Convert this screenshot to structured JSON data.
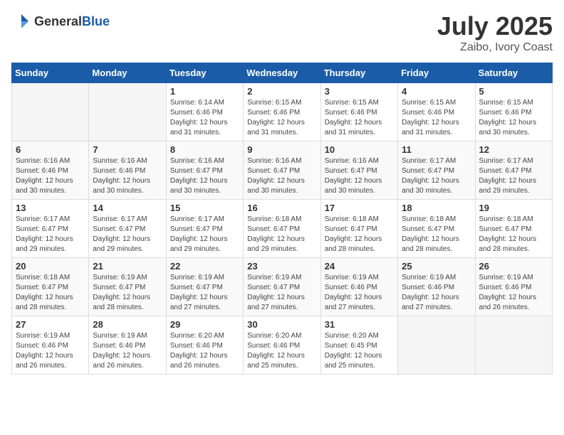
{
  "header": {
    "logo_general": "General",
    "logo_blue": "Blue",
    "month": "July 2025",
    "location": "Zaibo, Ivory Coast"
  },
  "weekdays": [
    "Sunday",
    "Monday",
    "Tuesday",
    "Wednesday",
    "Thursday",
    "Friday",
    "Saturday"
  ],
  "weeks": [
    [
      {
        "day": "",
        "sunrise": "",
        "sunset": "",
        "daylight": ""
      },
      {
        "day": "",
        "sunrise": "",
        "sunset": "",
        "daylight": ""
      },
      {
        "day": "1",
        "sunrise": "Sunrise: 6:14 AM",
        "sunset": "Sunset: 6:46 PM",
        "daylight": "Daylight: 12 hours and 31 minutes."
      },
      {
        "day": "2",
        "sunrise": "Sunrise: 6:15 AM",
        "sunset": "Sunset: 6:46 PM",
        "daylight": "Daylight: 12 hours and 31 minutes."
      },
      {
        "day": "3",
        "sunrise": "Sunrise: 6:15 AM",
        "sunset": "Sunset: 6:46 PM",
        "daylight": "Daylight: 12 hours and 31 minutes."
      },
      {
        "day": "4",
        "sunrise": "Sunrise: 6:15 AM",
        "sunset": "Sunset: 6:46 PM",
        "daylight": "Daylight: 12 hours and 31 minutes."
      },
      {
        "day": "5",
        "sunrise": "Sunrise: 6:15 AM",
        "sunset": "Sunset: 6:46 PM",
        "daylight": "Daylight: 12 hours and 30 minutes."
      }
    ],
    [
      {
        "day": "6",
        "sunrise": "Sunrise: 6:16 AM",
        "sunset": "Sunset: 6:46 PM",
        "daylight": "Daylight: 12 hours and 30 minutes."
      },
      {
        "day": "7",
        "sunrise": "Sunrise: 6:16 AM",
        "sunset": "Sunset: 6:46 PM",
        "daylight": "Daylight: 12 hours and 30 minutes."
      },
      {
        "day": "8",
        "sunrise": "Sunrise: 6:16 AM",
        "sunset": "Sunset: 6:47 PM",
        "daylight": "Daylight: 12 hours and 30 minutes."
      },
      {
        "day": "9",
        "sunrise": "Sunrise: 6:16 AM",
        "sunset": "Sunset: 6:47 PM",
        "daylight": "Daylight: 12 hours and 30 minutes."
      },
      {
        "day": "10",
        "sunrise": "Sunrise: 6:16 AM",
        "sunset": "Sunset: 6:47 PM",
        "daylight": "Daylight: 12 hours and 30 minutes."
      },
      {
        "day": "11",
        "sunrise": "Sunrise: 6:17 AM",
        "sunset": "Sunset: 6:47 PM",
        "daylight": "Daylight: 12 hours and 30 minutes."
      },
      {
        "day": "12",
        "sunrise": "Sunrise: 6:17 AM",
        "sunset": "Sunset: 6:47 PM",
        "daylight": "Daylight: 12 hours and 29 minutes."
      }
    ],
    [
      {
        "day": "13",
        "sunrise": "Sunrise: 6:17 AM",
        "sunset": "Sunset: 6:47 PM",
        "daylight": "Daylight: 12 hours and 29 minutes."
      },
      {
        "day": "14",
        "sunrise": "Sunrise: 6:17 AM",
        "sunset": "Sunset: 6:47 PM",
        "daylight": "Daylight: 12 hours and 29 minutes."
      },
      {
        "day": "15",
        "sunrise": "Sunrise: 6:17 AM",
        "sunset": "Sunset: 6:47 PM",
        "daylight": "Daylight: 12 hours and 29 minutes."
      },
      {
        "day": "16",
        "sunrise": "Sunrise: 6:18 AM",
        "sunset": "Sunset: 6:47 PM",
        "daylight": "Daylight: 12 hours and 29 minutes."
      },
      {
        "day": "17",
        "sunrise": "Sunrise: 6:18 AM",
        "sunset": "Sunset: 6:47 PM",
        "daylight": "Daylight: 12 hours and 28 minutes."
      },
      {
        "day": "18",
        "sunrise": "Sunrise: 6:18 AM",
        "sunset": "Sunset: 6:47 PM",
        "daylight": "Daylight: 12 hours and 28 minutes."
      },
      {
        "day": "19",
        "sunrise": "Sunrise: 6:18 AM",
        "sunset": "Sunset: 6:47 PM",
        "daylight": "Daylight: 12 hours and 28 minutes."
      }
    ],
    [
      {
        "day": "20",
        "sunrise": "Sunrise: 6:18 AM",
        "sunset": "Sunset: 6:47 PM",
        "daylight": "Daylight: 12 hours and 28 minutes."
      },
      {
        "day": "21",
        "sunrise": "Sunrise: 6:19 AM",
        "sunset": "Sunset: 6:47 PM",
        "daylight": "Daylight: 12 hours and 28 minutes."
      },
      {
        "day": "22",
        "sunrise": "Sunrise: 6:19 AM",
        "sunset": "Sunset: 6:47 PM",
        "daylight": "Daylight: 12 hours and 27 minutes."
      },
      {
        "day": "23",
        "sunrise": "Sunrise: 6:19 AM",
        "sunset": "Sunset: 6:47 PM",
        "daylight": "Daylight: 12 hours and 27 minutes."
      },
      {
        "day": "24",
        "sunrise": "Sunrise: 6:19 AM",
        "sunset": "Sunset: 6:46 PM",
        "daylight": "Daylight: 12 hours and 27 minutes."
      },
      {
        "day": "25",
        "sunrise": "Sunrise: 6:19 AM",
        "sunset": "Sunset: 6:46 PM",
        "daylight": "Daylight: 12 hours and 27 minutes."
      },
      {
        "day": "26",
        "sunrise": "Sunrise: 6:19 AM",
        "sunset": "Sunset: 6:46 PM",
        "daylight": "Daylight: 12 hours and 26 minutes."
      }
    ],
    [
      {
        "day": "27",
        "sunrise": "Sunrise: 6:19 AM",
        "sunset": "Sunset: 6:46 PM",
        "daylight": "Daylight: 12 hours and 26 minutes."
      },
      {
        "day": "28",
        "sunrise": "Sunrise: 6:19 AM",
        "sunset": "Sunset: 6:46 PM",
        "daylight": "Daylight: 12 hours and 26 minutes."
      },
      {
        "day": "29",
        "sunrise": "Sunrise: 6:20 AM",
        "sunset": "Sunset: 6:46 PM",
        "daylight": "Daylight: 12 hours and 26 minutes."
      },
      {
        "day": "30",
        "sunrise": "Sunrise: 6:20 AM",
        "sunset": "Sunset: 6:46 PM",
        "daylight": "Daylight: 12 hours and 25 minutes."
      },
      {
        "day": "31",
        "sunrise": "Sunrise: 6:20 AM",
        "sunset": "Sunset: 6:45 PM",
        "daylight": "Daylight: 12 hours and 25 minutes."
      },
      {
        "day": "",
        "sunrise": "",
        "sunset": "",
        "daylight": ""
      },
      {
        "day": "",
        "sunrise": "",
        "sunset": "",
        "daylight": ""
      }
    ]
  ]
}
